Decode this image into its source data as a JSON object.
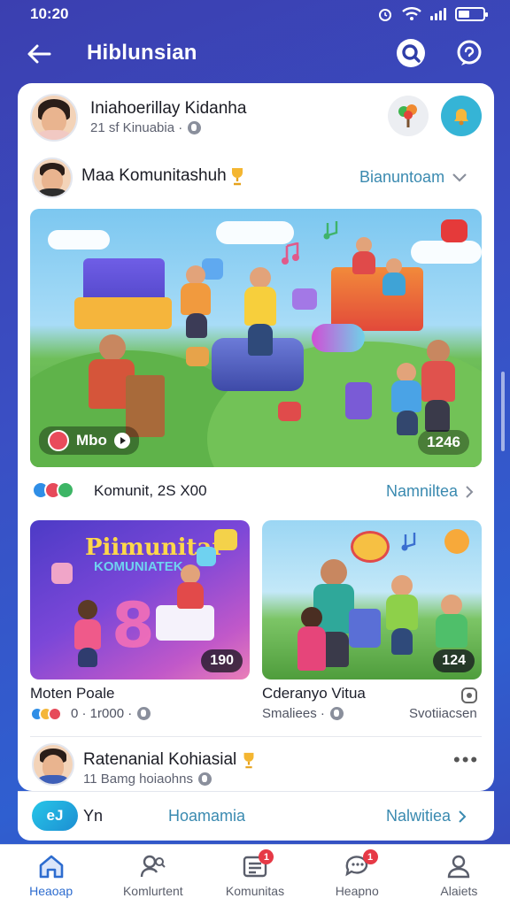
{
  "status_bar": {
    "time": "10:20"
  },
  "header": {
    "title": "Hiblunsian"
  },
  "post_author": {
    "name": "Iniahoerillay Kidanha",
    "meta": "21 sf Kinuabia ·"
  },
  "group_row": {
    "name": "Maa Komunitashuh",
    "action": "Bianuntoam"
  },
  "main_media": {
    "left_label": "Mbo",
    "right_label": "1246"
  },
  "reactions_row": {
    "text": "Komunit, 2S X00",
    "link": "Namniltea"
  },
  "thumb_left": {
    "title_line1": "Piimunitar",
    "title_line2": "KOMUNIATEK",
    "count": "190",
    "caption": "Moten Poale",
    "meta": "0 · 1r000 ·"
  },
  "thumb_right": {
    "count": "124",
    "caption": "Cderanyo Vitua",
    "meta": "Smaliees ·",
    "meta_right": "Svotiiacsen"
  },
  "second_post": {
    "name": "Ratenanial Kohiasial",
    "meta": "11 Bamg hoiaohns"
  },
  "bottom_bar": {
    "logo": "eJ",
    "label": "Yn",
    "center": "Hoamamia",
    "link": "Nalwitiea"
  },
  "tabs": [
    {
      "label": "Heaoap",
      "icon": "home-icon",
      "active": true
    },
    {
      "label": "Komlurtent",
      "icon": "people-search-icon",
      "active": false
    },
    {
      "label": "Komunitas",
      "icon": "news-icon",
      "active": false,
      "badge": "1"
    },
    {
      "label": "Heapno",
      "icon": "chat-icon",
      "active": false,
      "badge": "1"
    },
    {
      "label": "Alaiets",
      "icon": "profile-icon",
      "active": false
    }
  ],
  "colors": {
    "accent": "#2d6ccf",
    "link": "#3a8ab0",
    "badge": "#e63946"
  }
}
